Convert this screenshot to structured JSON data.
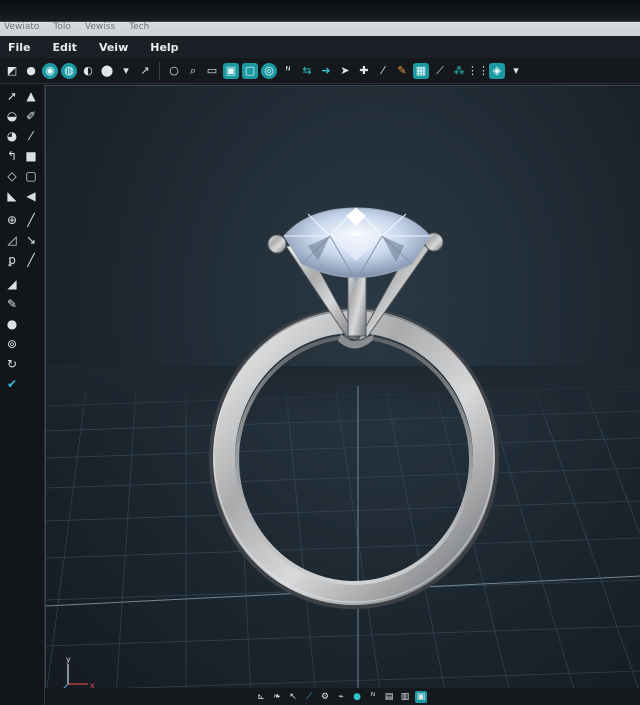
{
  "title_menu": [
    "Vewiato",
    "Tolo",
    "Vewiss",
    "Tech"
  ],
  "menubar": {
    "items": [
      {
        "label": "File"
      },
      {
        "label": "Edit"
      },
      {
        "label": "Veiw"
      },
      {
        "label": "Help"
      }
    ]
  },
  "toolbar": {
    "icons": [
      "cube-icon",
      "sphere-icon",
      "teal-globe-icon",
      "teal-sphere-icon",
      "sphere-gray-icon",
      "gem-icon",
      "arrow-icon",
      "circle-select-icon",
      "zoom-icon",
      "frame-icon",
      "teal-square-icon",
      "teal-square-2-icon",
      "camera-icon",
      "text-icon",
      "move-left-icon",
      "move-right-icon",
      "plus-icon",
      "brush-icon",
      "pen-icon",
      "light-icon",
      "render-icon",
      "sparkle-icon",
      "settings-icon"
    ]
  },
  "lefttools": {
    "icons": [
      "select-arrow-icon",
      "lasso-icon",
      "sphere-tool-icon",
      "pencil-icon",
      "rotate-icon",
      "knife-icon",
      "curve-icon",
      "square-tool-icon",
      "shield-icon",
      "back-arrow-icon",
      "circle-tool-icon",
      "brush-tool-icon",
      "triangle-tool-icon",
      "pipette-icon",
      "paint-icon",
      "eraser-icon",
      "pen-tool-icon",
      "sphere-small-icon",
      "eye-icon",
      "refresh-icon",
      "check-icon"
    ]
  },
  "viewport": {
    "axis_labels": {
      "x": "x",
      "y": "y"
    }
  },
  "bottombar": {
    "icons": [
      "ruler-icon",
      "leaf-icon",
      "cursor-icon",
      "brush-icon",
      "gear-icon",
      "camera-icon",
      "teal-orb-icon",
      "text-icon",
      "chart-icon",
      "layers-icon",
      "teal-active-icon"
    ]
  },
  "colors": {
    "accent": "#1c9aa3",
    "viewport": "#1d2730",
    "grid": "#3c5260",
    "ring_metal": "#c9cbcc",
    "diamond": "#dfe8f5"
  }
}
